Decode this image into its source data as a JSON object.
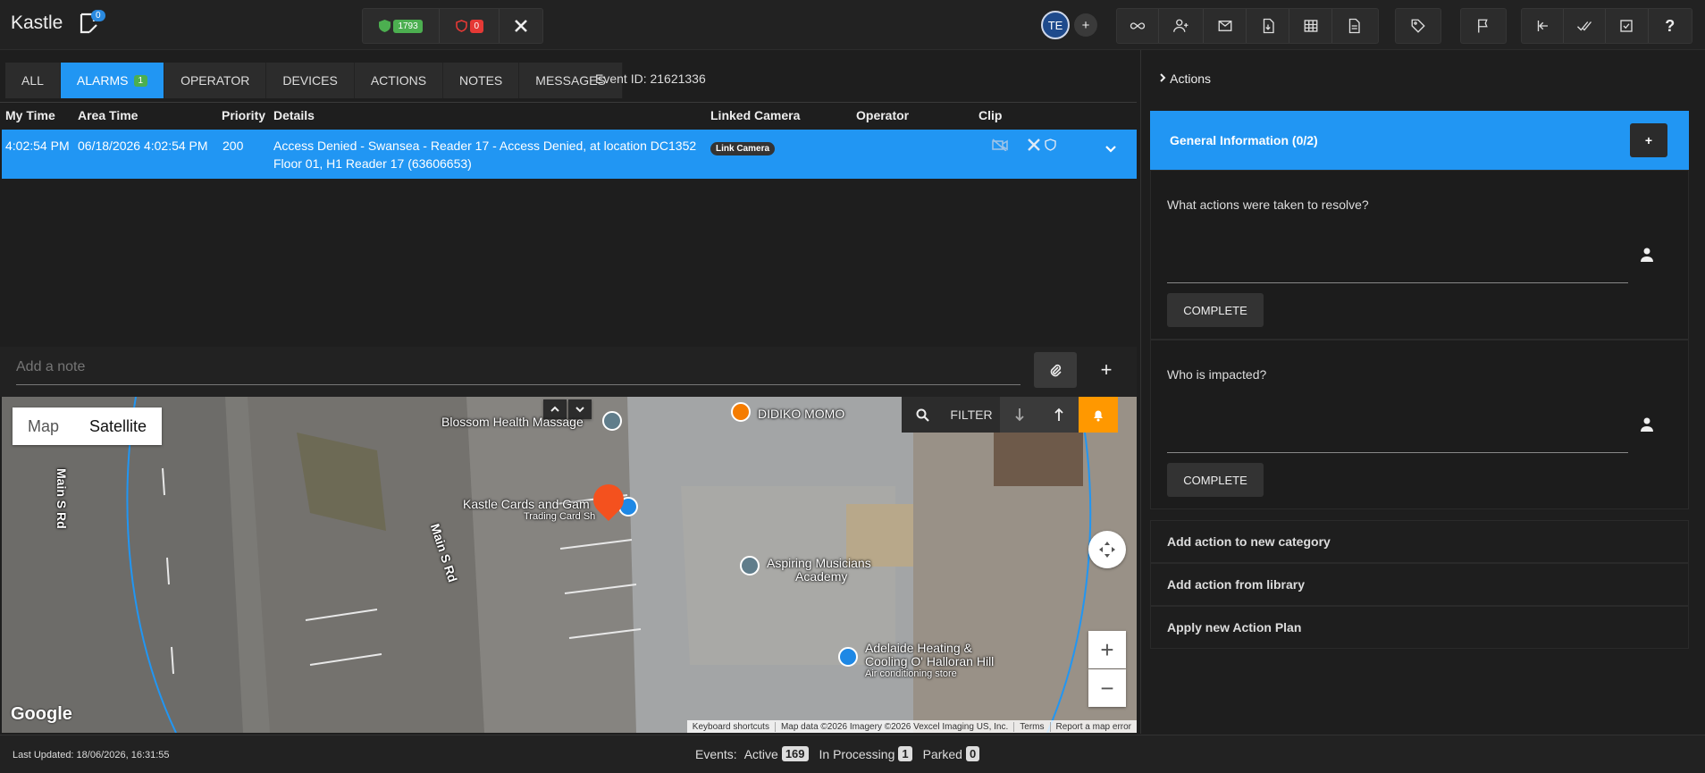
{
  "app": {
    "title": "Kastle",
    "notification_count": "0"
  },
  "status_counts": {
    "ok": "1793",
    "alert": "0"
  },
  "user": {
    "initials": "TE"
  },
  "tabs": [
    {
      "label": "ALL"
    },
    {
      "label": "ALARMS",
      "badge": "1"
    },
    {
      "label": "OPERATOR"
    },
    {
      "label": "DEVICES"
    },
    {
      "label": "ACTIONS"
    },
    {
      "label": "NOTES"
    },
    {
      "label": "MESSAGES"
    }
  ],
  "event_id": "Event ID: 21621336",
  "table": {
    "headers": [
      "My Time",
      "Area Time",
      "Priority",
      "Details",
      "Linked Camera",
      "Operator",
      "Clip"
    ],
    "rows": [
      {
        "my_time": "4:02:54 PM",
        "area_time": "06/18/2026 4:02:54 PM",
        "priority": "200",
        "details_line1": "Access Denied - Swansea - Reader 17 - Access Denied, at location DC1352",
        "details_line2": "Floor 01, H1 Reader 17 (63606653)",
        "linked_camera": "Link Camera"
      }
    ]
  },
  "note": {
    "placeholder": "Add a note"
  },
  "map": {
    "type_map": "Map",
    "type_satellite": "Satellite",
    "filter": "FILTER",
    "places": {
      "blossom": "Blossom Health Massage",
      "didiko": "DIDIKO MOMO",
      "kastle": "Kastle Cards and Gam",
      "kastle_sub": "Trading Card Sh",
      "aspiring1": "Aspiring Musicians",
      "aspiring2": "Academy",
      "adelaide1": "Adelaide Heating &",
      "adelaide2": "Cooling O' Halloran Hill",
      "adelaide_sub": "Air conditioning store",
      "road1": "Main S Rd",
      "road2": "Main S Rd"
    },
    "google": "Google",
    "attribution": {
      "shortcuts": "Keyboard shortcuts",
      "data": "Map data ©2026 Imagery ©2026 Vexcel Imaging US, Inc.",
      "terms": "Terms",
      "report": "Report a map error"
    }
  },
  "actions_panel": {
    "header": "Actions",
    "general": "General Information (0/2)",
    "add_label": "+",
    "questions": [
      {
        "text": "What actions were taken to resolve?",
        "button": "COMPLETE"
      },
      {
        "text": "Who is impacted?",
        "button": "COMPLETE"
      }
    ],
    "links": [
      "Add action to new category",
      "Add action from library",
      "Apply new Action Plan"
    ]
  },
  "footer": {
    "last_updated": "Last Updated: 18/06/2026, 16:31:55",
    "events_label": "Events:",
    "active_label": "Active",
    "active": "169",
    "processing_label": "In Processing",
    "processing": "1",
    "parked_label": "Parked",
    "parked": "0"
  }
}
